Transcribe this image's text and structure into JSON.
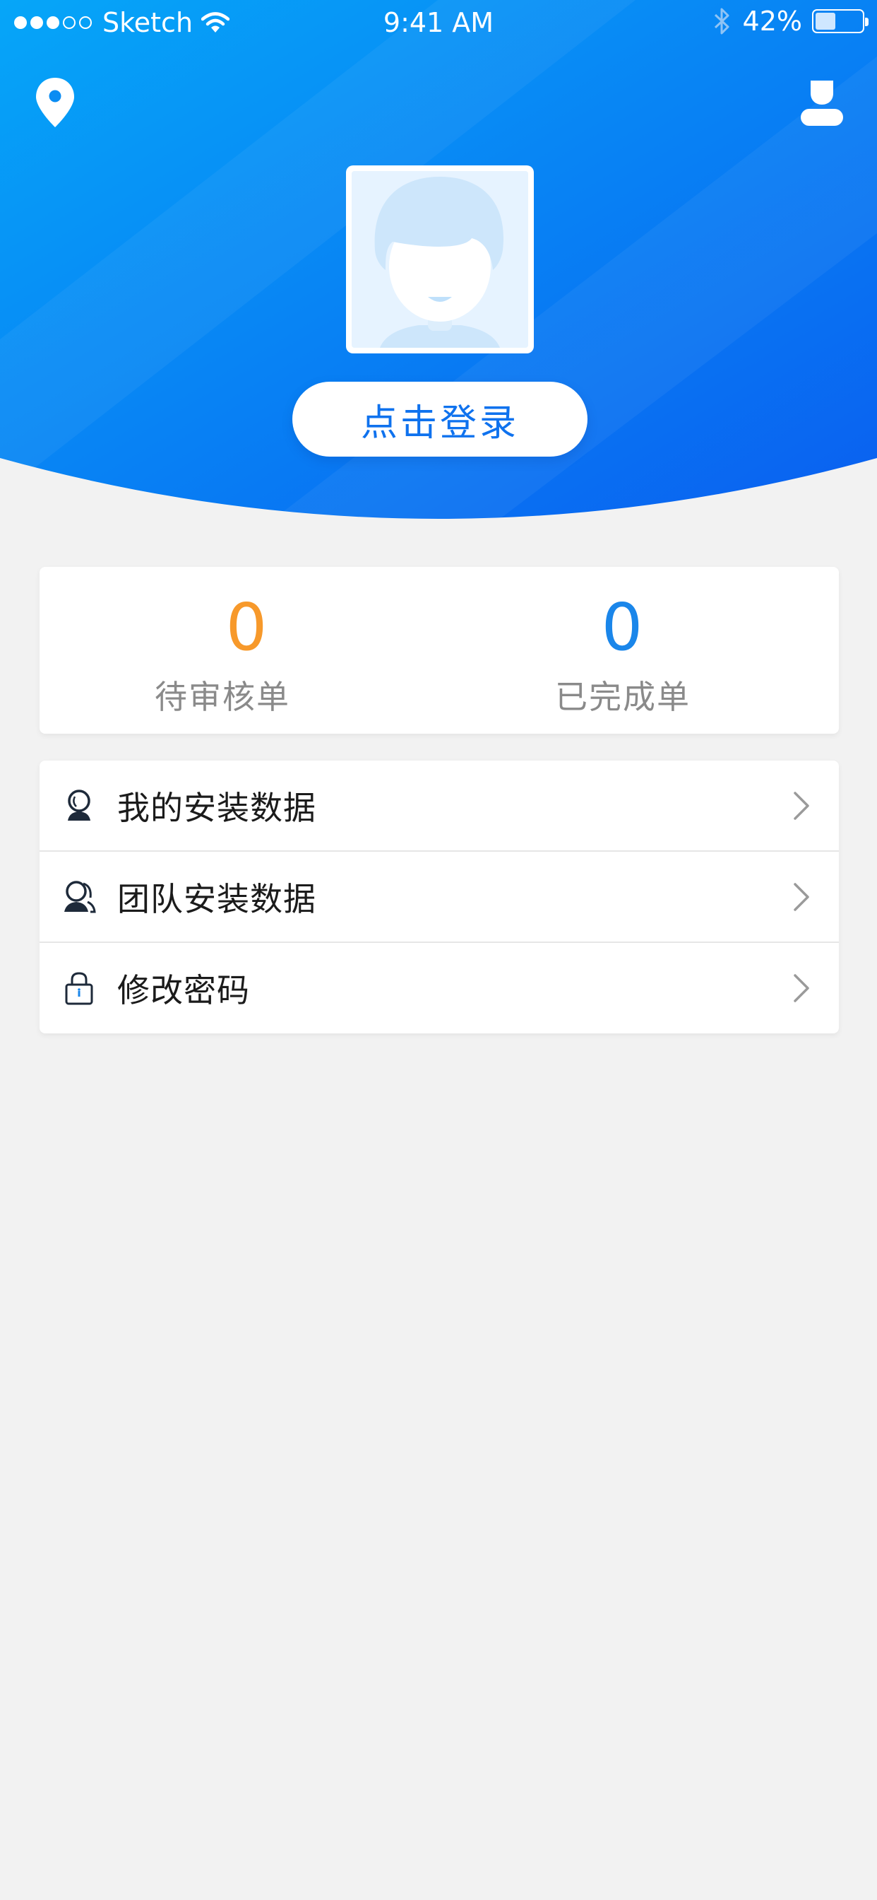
{
  "status_bar": {
    "carrier": "Sketch",
    "time": "9:41 AM",
    "battery": "42%",
    "battery_level": 0.42
  },
  "header": {
    "location_icon": "location-pin-icon",
    "user_icon": "user-icon",
    "avatar": "default-avatar",
    "login_label": "点击登录"
  },
  "colors": {
    "header_gradient_start": "#06a6f8",
    "header_gradient_end": "#0a5ff0",
    "accent_blue": "#0f72ee",
    "pending_orange": "#f7992b",
    "completed_blue": "#1a86ea",
    "page_bg": "#f2f2f2"
  },
  "stats": [
    {
      "value": "0",
      "label": "待审核单"
    },
    {
      "value": "0",
      "label": "已完成单"
    }
  ],
  "menu": [
    {
      "icon": "personal-data-icon",
      "label": "我的安装数据"
    },
    {
      "icon": "team-data-icon",
      "label": "团队安装数据"
    },
    {
      "icon": "lock-icon",
      "label": "修改密码"
    }
  ]
}
